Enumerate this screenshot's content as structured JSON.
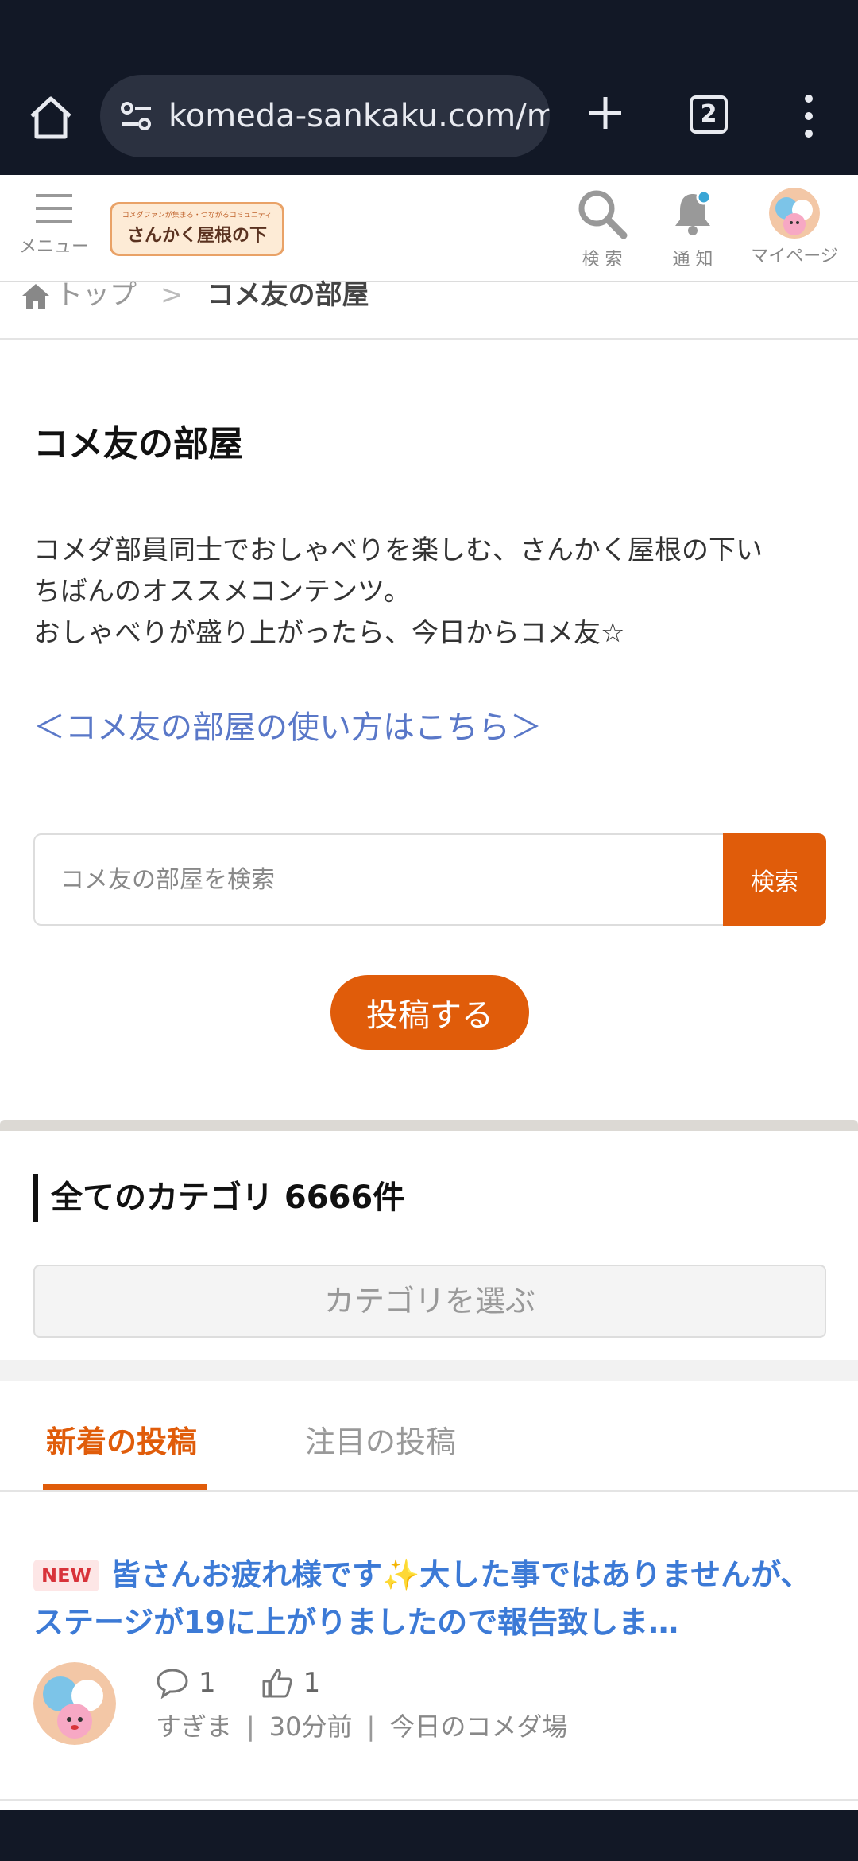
{
  "browser": {
    "url": "komeda-sankaku.com/m",
    "tab_count": "2"
  },
  "header": {
    "menu_label": "メニュー",
    "logo_tagline": "コメダファンが集まる・つながるコミュニティ",
    "logo_name": "さんかく屋根の下",
    "search_label": "検 索",
    "notify_label": "通 知",
    "mypage_label": "マイページ"
  },
  "breadcrumb": {
    "top": "トップ",
    "separator": ">",
    "current": "コメ友の部屋"
  },
  "intro": {
    "title": "コメ友の部屋",
    "text_line1": "コメダ部員同士でおしゃべりを楽しむ、さんかく屋根の下い",
    "text_line2": "ちばんのオススメコンテンツ。",
    "text_line3": "おしゃべりが盛り上がったら、今日からコメ友☆",
    "howto_link": "＜コメ友の部屋の使い方はこちら＞"
  },
  "search": {
    "placeholder": "コメ友の部屋を検索",
    "button": "検索"
  },
  "post_button": "投稿する",
  "category": {
    "heading": "全てのカテゴリ 6666件",
    "select": "カテゴリを選ぶ"
  },
  "tabs": {
    "new": "新着の投稿",
    "hot": "注目の投稿"
  },
  "posts": [
    {
      "badge": "NEW",
      "title": "皆さんお疲れ様です✨大した事ではありませんが、ステージが19に上がりましたので報告致しま…",
      "comments": "1",
      "likes": "1",
      "author": "すぎま",
      "time": "30分前",
      "category": "今日のコメダ場"
    }
  ],
  "colors": {
    "accent": "#e05c0a",
    "link": "#5a78c8",
    "post_title": "#3c7ad6",
    "chrome_bg": "#121826"
  },
  "icons": [
    "home-icon",
    "site-settings-icon",
    "plus-icon",
    "tab-switcher-icon",
    "more-icon",
    "menu-icon",
    "search-icon",
    "bell-icon",
    "house-icon",
    "comment-icon",
    "thumbs-up-icon"
  ]
}
